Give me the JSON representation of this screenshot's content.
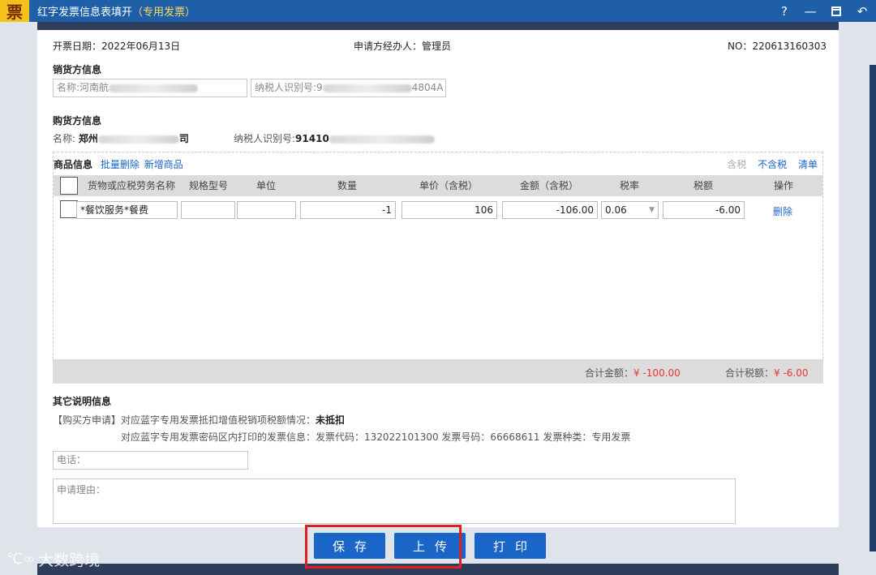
{
  "titlebar": {
    "app_icon": "票",
    "title": "红字发票信息表填开",
    "subtitle": "（专用发票）",
    "help": "?",
    "minimize": "—",
    "back": "↶"
  },
  "header": {
    "date_label": "开票日期：",
    "date_value": "2022年06月13日",
    "applicant_label": "申请方经办人：",
    "applicant_value": "管理员",
    "no_label": "NO：",
    "no_value": "220613160303"
  },
  "seller": {
    "section_title": "销货方信息",
    "name_field": "名称:河南航",
    "tax_id_field": "纳税人识别号:9",
    "tax_id_tail": "4804A"
  },
  "buyer": {
    "section_title": "购货方信息",
    "name_label": "名称:",
    "name_value": "郑州",
    "name_tail": "司",
    "tax_id_label": "纳税人识别号:",
    "tax_id_value": "91410"
  },
  "goods": {
    "section_title": "商品信息",
    "batch_delete": "批量删除",
    "add_item": "新增商品",
    "tax_incl": "含税",
    "tax_excl": "不含税",
    "clear": "清单",
    "columns": [
      "货物或应税劳务名称",
      "规格型号",
      "单位",
      "数量",
      "单价（含税）",
      "金额（含税）",
      "税率",
      "税额",
      "操作"
    ],
    "rows": [
      {
        "name": "*餐饮服务*餐费",
        "spec": "",
        "unit": "",
        "quantity": "-1",
        "unit_price": "106",
        "amount": "-106.00",
        "tax_rate": "0.06",
        "tax_amount": "-6.00",
        "action": "删除"
      }
    ],
    "total_amount_label": "合计金额：",
    "total_amount_value": "¥ -100.00",
    "total_tax_label": "合计税额：",
    "total_tax_value": "¥ -6.00"
  },
  "other": {
    "section_title": "其它说明信息",
    "buyer_apply_label": "【购买方申请】",
    "line1": "对应蓝字专用发票抵扣增值税销项税额情况：",
    "line1_value": "未抵扣",
    "line2": "对应蓝字专用发票密码区内打印的发票信息：发票代码：132022101300 发票号码：66668611 发票种类：专用发票",
    "phone_placeholder": "电话：",
    "reason_placeholder": "申请理由："
  },
  "actions": {
    "save": "保存",
    "upload": "上传",
    "print": "打印"
  },
  "watermark": {
    "text": "大数跨境"
  },
  "colors": {
    "titlebar": "#1f5fa8",
    "accent": "#1a66c8",
    "negative": "#e33333",
    "highlight": "#e02020"
  }
}
